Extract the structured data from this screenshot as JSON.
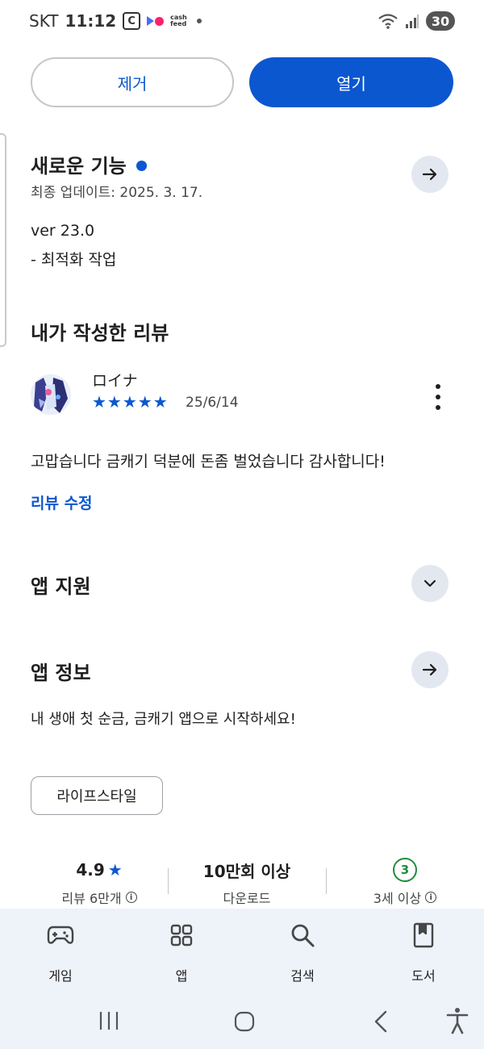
{
  "status_bar": {
    "carrier": "SKT",
    "time": "11:12",
    "notif_icon_letter": "C",
    "cashfeed_line1": "cash",
    "cashfeed_line2": "feed",
    "battery": "30"
  },
  "actions": {
    "remove_label": "제거",
    "open_label": "열기"
  },
  "whats_new": {
    "title": "새로운 기능",
    "last_updated": "최종 업데이트: 2025. 3. 17.",
    "version": "ver 23.0",
    "notes": "- 최적화 작업"
  },
  "my_review": {
    "title": "내가 작성한 리뷰",
    "reviewer_name": "ロイナ",
    "stars": "★★★★★",
    "rating": 5,
    "date": "25/6/14",
    "text": "고맙습니다 금캐기 덕분에 돈좀 벌었습니다 감사합니다!",
    "edit_label": "리뷰 수정"
  },
  "app_support": {
    "title": "앱 지원"
  },
  "app_info": {
    "title": "앱 정보",
    "description": "내 생애 첫 순금, 금캐기 앱으로 시작하세요!",
    "category_chip": "라이프스타일"
  },
  "stats": {
    "rating_value": "4.9",
    "rating_star": "★",
    "rating_label": "리뷰 6만개",
    "downloads_value": "10만회 이상",
    "downloads_label": "다운로드",
    "age_value": "3",
    "age_label": "3세 이상",
    "info_glyph": "i"
  },
  "bottom_nav": {
    "items": [
      {
        "label": "게임",
        "icon": "gamepad-icon"
      },
      {
        "label": "앱",
        "icon": "apps-grid-icon"
      },
      {
        "label": "검색",
        "icon": "search-icon"
      },
      {
        "label": "도서",
        "icon": "book-icon"
      }
    ]
  },
  "colors": {
    "accent": "#0b57d0",
    "age_green": "#1e8e3e",
    "nav_bg": "#eef2f9"
  }
}
